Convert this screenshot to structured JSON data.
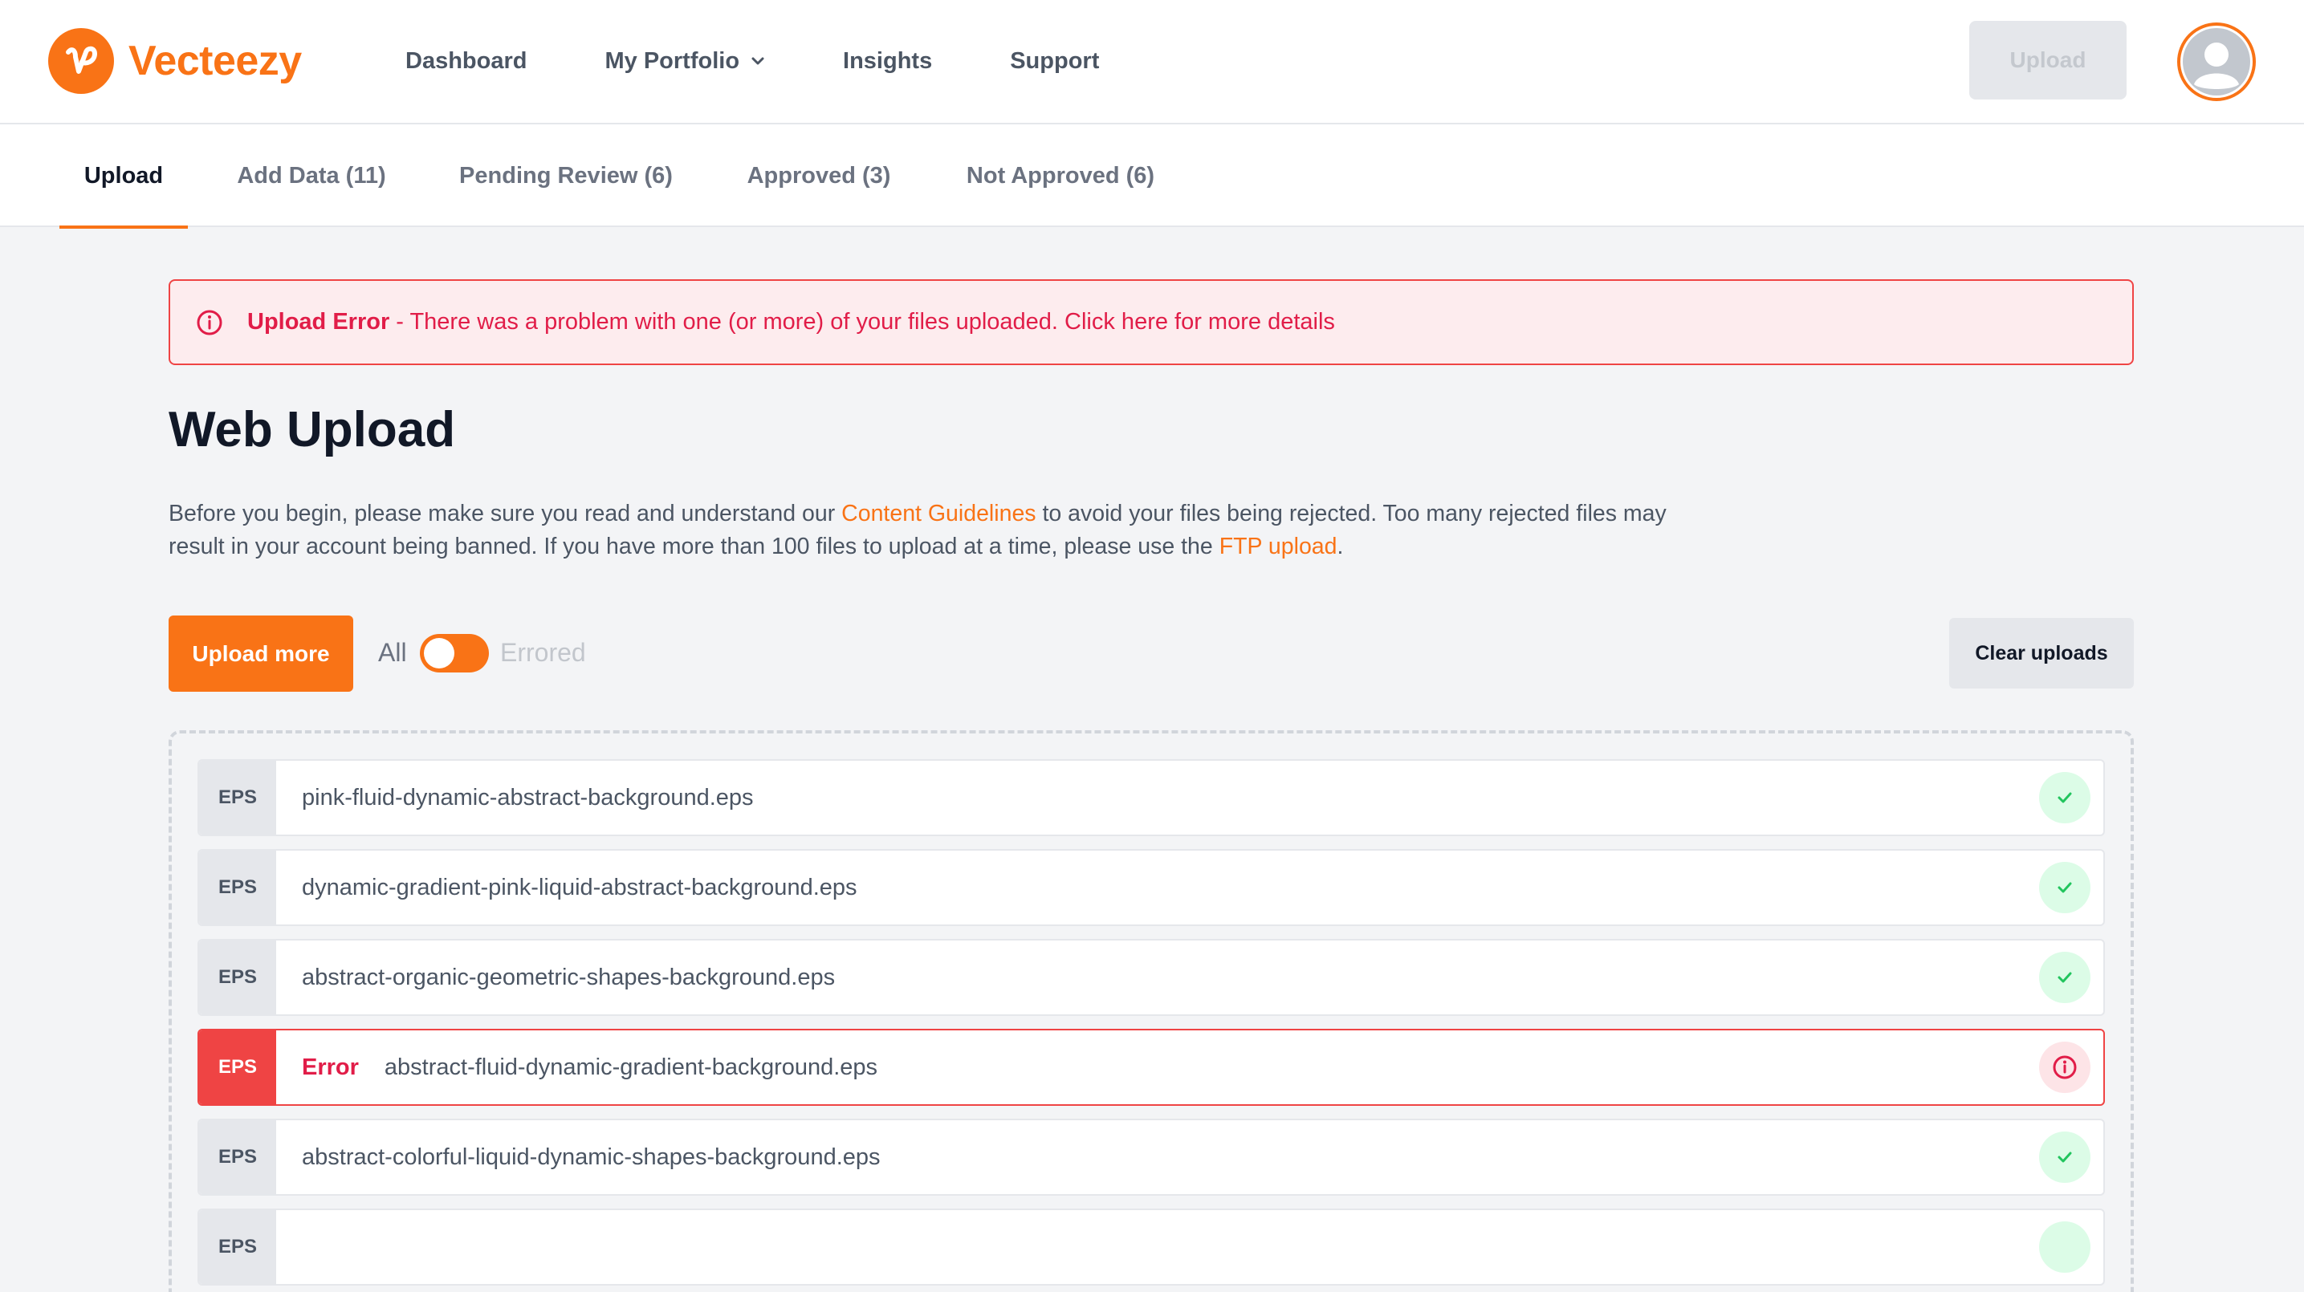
{
  "brand": {
    "name": "Vecteezy",
    "color": "#f97316"
  },
  "nav": {
    "items": [
      {
        "label": "Dashboard"
      },
      {
        "label": "My Portfolio",
        "has_dropdown": true
      },
      {
        "label": "Insights"
      },
      {
        "label": "Support"
      }
    ],
    "upload_label": "Upload"
  },
  "tabs": [
    {
      "label": "Upload",
      "active": true
    },
    {
      "label": "Add Data (11)"
    },
    {
      "label": "Pending Review (6)"
    },
    {
      "label": "Approved (3)"
    },
    {
      "label": "Not Approved (6)"
    }
  ],
  "alert": {
    "title": "Upload Error",
    "message": "- There was a problem with one (or more) of your files uploaded. Click here for more details"
  },
  "page": {
    "title": "Web Upload",
    "intro_1": "Before you begin, please make sure you read and understand our ",
    "intro_link_1": "Content Guidelines",
    "intro_2": " to avoid your files being rejected. Too many rejected files may result in your account being banned. If you have more than 100 files to upload at a time, please use the ",
    "intro_link_2": "FTP upload",
    "intro_3": "."
  },
  "controls": {
    "upload_more": "Upload more",
    "filter_all": "All",
    "filter_errored": "Errored",
    "clear_uploads": "Clear uploads"
  },
  "files": [
    {
      "type": "EPS",
      "name": "pink-fluid-dynamic-abstract-background.eps",
      "status": "success"
    },
    {
      "type": "EPS",
      "name": "dynamic-gradient-pink-liquid-abstract-background.eps",
      "status": "success"
    },
    {
      "type": "EPS",
      "name": "abstract-organic-geometric-shapes-background.eps",
      "status": "success"
    },
    {
      "type": "EPS",
      "name": "abstract-fluid-dynamic-gradient-background.eps",
      "status": "error",
      "error_label": "Error"
    },
    {
      "type": "EPS",
      "name": "abstract-colorful-liquid-dynamic-shapes-background.eps",
      "status": "success"
    },
    {
      "type": "EPS",
      "name": "",
      "status": "success"
    }
  ]
}
